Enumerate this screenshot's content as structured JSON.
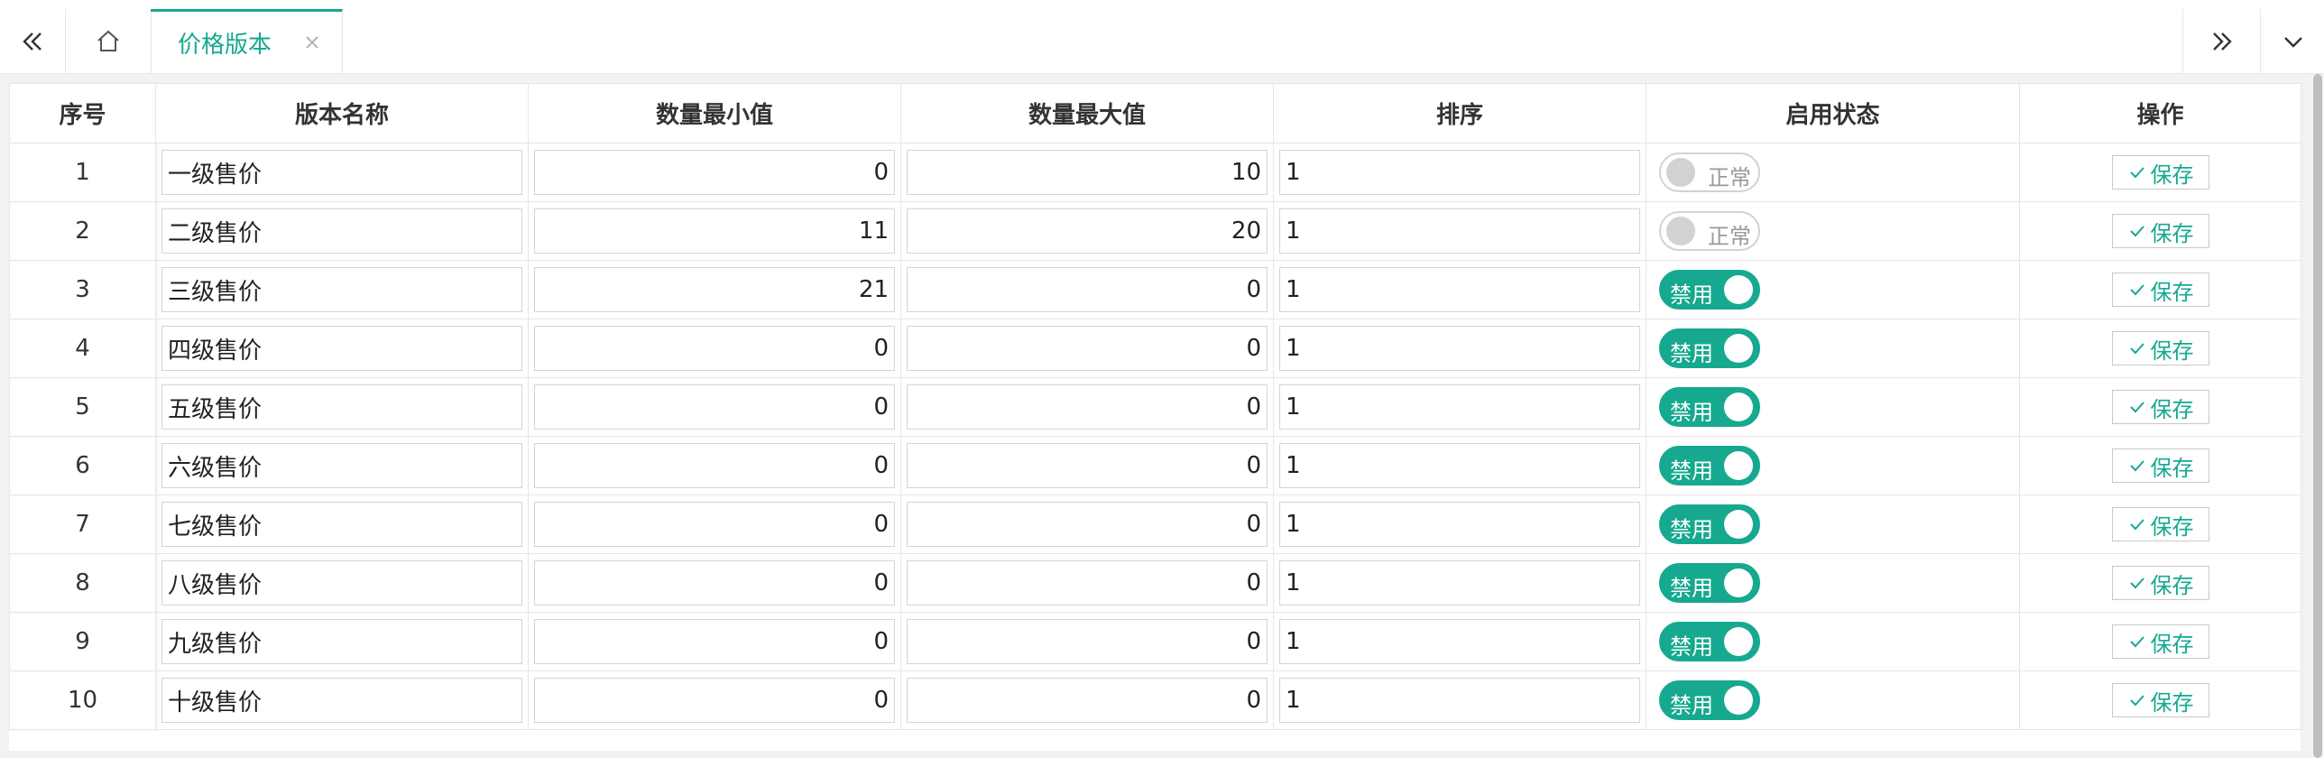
{
  "tabbar": {
    "prev_icon": "double-chevron-left-icon",
    "home_icon": "home-icon",
    "active_tab": {
      "label": "价格版本",
      "close_icon": "close-icon"
    },
    "next_icon": "double-chevron-right-icon",
    "more_icon": "chevron-down-icon"
  },
  "table": {
    "headers": [
      "序号",
      "版本名称",
      "数量最小值",
      "数量最大值",
      "排序",
      "启用状态",
      "操作"
    ],
    "rows": [
      {
        "seq": "1",
        "name": "一级售价",
        "min": "0",
        "max": "10",
        "sort": "1",
        "status_on": false,
        "status_text": "正常",
        "action": "保存"
      },
      {
        "seq": "2",
        "name": "二级售价",
        "min": "11",
        "max": "20",
        "sort": "1",
        "status_on": false,
        "status_text": "正常",
        "action": "保存"
      },
      {
        "seq": "3",
        "name": "三级售价",
        "min": "21",
        "max": "0",
        "sort": "1",
        "status_on": true,
        "status_text": "禁用",
        "action": "保存"
      },
      {
        "seq": "4",
        "name": "四级售价",
        "min": "0",
        "max": "0",
        "sort": "1",
        "status_on": true,
        "status_text": "禁用",
        "action": "保存"
      },
      {
        "seq": "5",
        "name": "五级售价",
        "min": "0",
        "max": "0",
        "sort": "1",
        "status_on": true,
        "status_text": "禁用",
        "action": "保存"
      },
      {
        "seq": "6",
        "name": "六级售价",
        "min": "0",
        "max": "0",
        "sort": "1",
        "status_on": true,
        "status_text": "禁用",
        "action": "保存"
      },
      {
        "seq": "7",
        "name": "七级售价",
        "min": "0",
        "max": "0",
        "sort": "1",
        "status_on": true,
        "status_text": "禁用",
        "action": "保存"
      },
      {
        "seq": "8",
        "name": "八级售价",
        "min": "0",
        "max": "0",
        "sort": "1",
        "status_on": true,
        "status_text": "禁用",
        "action": "保存"
      },
      {
        "seq": "9",
        "name": "九级售价",
        "min": "0",
        "max": "0",
        "sort": "1",
        "status_on": true,
        "status_text": "禁用",
        "action": "保存"
      },
      {
        "seq": "10",
        "name": "十级售价",
        "min": "0",
        "max": "0",
        "sort": "1",
        "status_on": true,
        "status_text": "禁用",
        "action": "保存"
      }
    ]
  },
  "colors": {
    "accent": "#16a98f",
    "switch_off": "#d2d2d2",
    "border": "#e6e6e6"
  }
}
